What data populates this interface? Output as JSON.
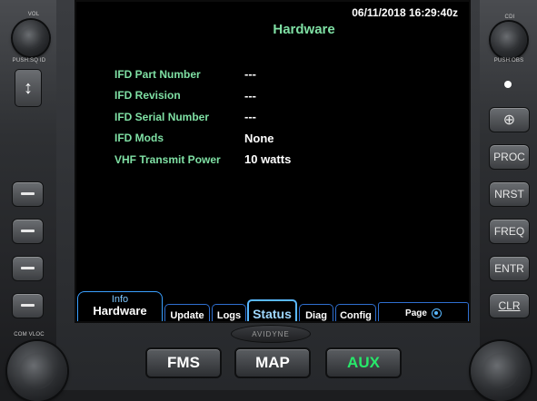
{
  "bezel": {
    "left_top_knob_label": "VOL",
    "left_push_label": "PUSH:SQ ID",
    "left_bottom_knob_label": "COM VLOC",
    "right_top_knob_label": "CDI",
    "right_push_label": "PUSH:OBS",
    "brand": "AVIDYNE",
    "rocker_symbol": "↕",
    "obs_symbol": "⊕"
  },
  "right_buttons": [
    "PROC",
    "NRST",
    "FREQ",
    "ENTR",
    "CLR"
  ],
  "screen": {
    "datetime": "06/11/2018 16:29:40z",
    "title": "Hardware",
    "rows": [
      {
        "label": "IFD Part Number",
        "value": "---"
      },
      {
        "label": "IFD Revision",
        "value": "---"
      },
      {
        "label": "IFD Serial Number",
        "value": "---"
      },
      {
        "label": "IFD Mods",
        "value": "None"
      },
      {
        "label": "VHF Transmit Power",
        "value": "10 watts"
      }
    ]
  },
  "tabs": {
    "group_line1": "Info",
    "group_line2": "Hardware",
    "items": [
      "Update",
      "Logs",
      "Status",
      "Diag",
      "Config"
    ],
    "active": "Status",
    "page_label": "Page"
  },
  "modes": [
    "FMS",
    "MAP",
    "AUX"
  ],
  "colors": {
    "label_green": "#7fe0a4",
    "tab_blue": "#2f6fd0",
    "aux_green": "#27e86a"
  }
}
